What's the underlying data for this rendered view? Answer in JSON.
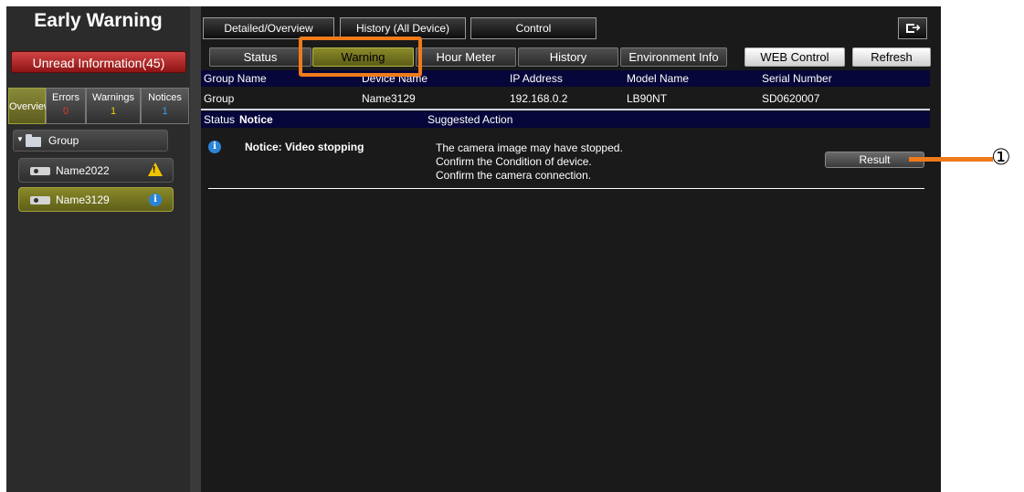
{
  "app": {
    "title": "Early Warning"
  },
  "sidebar": {
    "unread_label": "Unread Information(45)",
    "filters": [
      {
        "label": "Overview",
        "count": ""
      },
      {
        "label": "Errors",
        "count": "0",
        "color": "#e03a2a"
      },
      {
        "label": "Warnings",
        "count": "1",
        "color": "#f0d000"
      },
      {
        "label": "Notices",
        "count": "1",
        "color": "#3aa0e8"
      }
    ],
    "group": {
      "label": "Group",
      "icon": "folder-icon"
    },
    "devices": [
      {
        "label": "Name2022",
        "status_icon": "warning-icon"
      },
      {
        "label": "Name3129",
        "status_icon": "info-icon"
      }
    ]
  },
  "topnav": {
    "detailed": "Detailed/Overview",
    "history_all": "History (All Device)",
    "control": "Control",
    "exit_icon": "exit-icon"
  },
  "tabs": {
    "status": "Status",
    "warning": "Warning",
    "hour_meter": "Hour Meter",
    "history": "History",
    "environment": "Environment Info",
    "web_control": "WEB Control",
    "refresh": "Refresh"
  },
  "device_table": {
    "headers": [
      "Group Name",
      "Device Name",
      "IP Address",
      "Model Name",
      "Serial Number"
    ],
    "row": [
      "Group",
      "Name3129",
      "192.168.0.2",
      "LB90NT",
      "SD0620007"
    ]
  },
  "notice_table": {
    "headers": {
      "status": "Status",
      "notice": "Notice",
      "action": "Suggested Action"
    },
    "notice_title": "Notice: Video stopping",
    "actions": [
      "The camera image may have stopped.",
      "Confirm the Condition of device.",
      "Confirm the camera connection."
    ],
    "result_label": "Result"
  },
  "annotation": {
    "callout_number": "①",
    "accent": "#f07a1a"
  }
}
